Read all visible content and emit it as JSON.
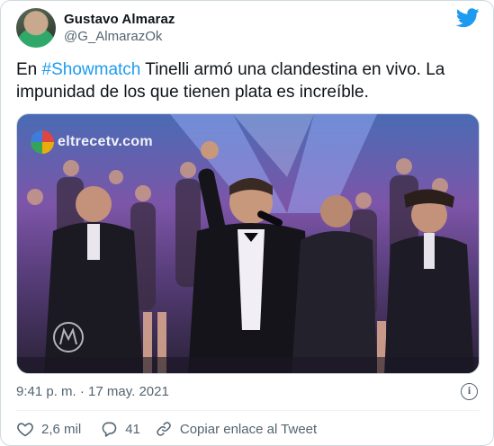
{
  "author": {
    "name": "Gustavo Almaraz",
    "handle": "@G_AlmarazOk"
  },
  "tweet": {
    "text_before": "En ",
    "hashtag": "#Showmatch",
    "text_after": " Tinelli armó una clandestina en vivo. La impunidad de los que tienen plata es increíble."
  },
  "media": {
    "watermark": "eltrecetv.com"
  },
  "meta": {
    "timestamp": "9:41 p. m. · 17 may. 2021"
  },
  "actions": {
    "likes": "2,6 mil",
    "replies": "41",
    "copy_link": "Copiar enlace al Tweet"
  },
  "icons": {
    "brand": "twitter-bird-icon",
    "info": "info-icon",
    "like": "heart-icon",
    "reply": "reply-bubble-icon",
    "link": "link-icon"
  },
  "colors": {
    "accent": "#1d9bf0",
    "secondary_text": "#536471",
    "border": "#cfd9de"
  }
}
